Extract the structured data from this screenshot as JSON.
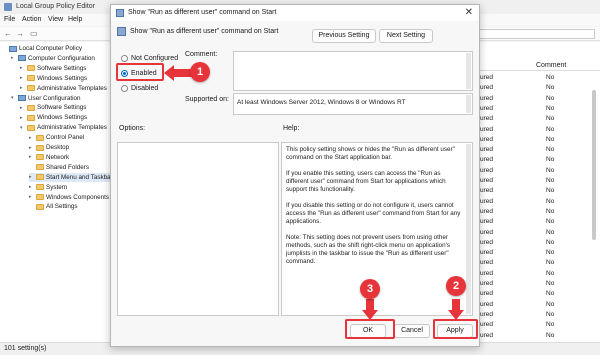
{
  "app": {
    "title": "Local Group Policy Editor",
    "menu": [
      "File",
      "Action",
      "View",
      "Help"
    ],
    "status": "101 setting(s)"
  },
  "tree": [
    {
      "label": "Local Computer Policy",
      "icon": "computer-icon",
      "depth": 0,
      "twisty": ""
    },
    {
      "label": "Computer Configuration",
      "icon": "computer-icon",
      "depth": 1,
      "twisty": "▸"
    },
    {
      "label": "Software Settings",
      "icon": "folder-icon",
      "depth": 2,
      "twisty": "▸"
    },
    {
      "label": "Windows Settings",
      "icon": "folder-icon",
      "depth": 2,
      "twisty": "▸"
    },
    {
      "label": "Administrative Templates",
      "icon": "folder-icon",
      "depth": 2,
      "twisty": "▸"
    },
    {
      "label": "User Configuration",
      "icon": "computer-icon",
      "depth": 1,
      "twisty": "▾"
    },
    {
      "label": "Software Settings",
      "icon": "folder-icon",
      "depth": 2,
      "twisty": "▸"
    },
    {
      "label": "Windows Settings",
      "icon": "folder-icon",
      "depth": 2,
      "twisty": "▸"
    },
    {
      "label": "Administrative Templates",
      "icon": "folder-icon",
      "depth": 2,
      "twisty": "▾"
    },
    {
      "label": "Control Panel",
      "icon": "folder-icon",
      "depth": 3,
      "twisty": "▸"
    },
    {
      "label": "Desktop",
      "icon": "folder-icon",
      "depth": 3,
      "twisty": "▸"
    },
    {
      "label": "Network",
      "icon": "folder-icon",
      "depth": 3,
      "twisty": "▸"
    },
    {
      "label": "Shared Folders",
      "icon": "folder-icon",
      "depth": 3,
      "twisty": ""
    },
    {
      "label": "Start Menu and Taskbar",
      "icon": "folder-icon",
      "depth": 3,
      "twisty": "▸",
      "selected": true
    },
    {
      "label": "System",
      "icon": "folder-icon",
      "depth": 3,
      "twisty": "▸"
    },
    {
      "label": "Windows Components",
      "icon": "folder-icon",
      "depth": 3,
      "twisty": "▸"
    },
    {
      "label": "All Settings",
      "icon": "folder-icon",
      "depth": 3,
      "twisty": ""
    }
  ],
  "list": {
    "header": "Comment",
    "rows": [
      {
        "state": "ured",
        "comment": "No"
      },
      {
        "state": "ured",
        "comment": "No"
      },
      {
        "state": "ured",
        "comment": "No"
      },
      {
        "state": "ured",
        "comment": "No"
      },
      {
        "state": "ured",
        "comment": "No"
      },
      {
        "state": "ured",
        "comment": "No"
      },
      {
        "state": "ured",
        "comment": "No"
      },
      {
        "state": "ured",
        "comment": "No"
      },
      {
        "state": "ured",
        "comment": "No"
      },
      {
        "state": "ured",
        "comment": "No"
      },
      {
        "state": "ured",
        "comment": "No"
      },
      {
        "state": "ured",
        "comment": "No"
      },
      {
        "state": "ured",
        "comment": "No"
      },
      {
        "state": "ured",
        "comment": "No"
      },
      {
        "state": "ured",
        "comment": "No"
      },
      {
        "state": "ured",
        "comment": "No"
      },
      {
        "state": "ured",
        "comment": "No"
      },
      {
        "state": "ured",
        "comment": "No"
      },
      {
        "state": "ured",
        "comment": "No"
      },
      {
        "state": "ured",
        "comment": "No"
      },
      {
        "state": "ured",
        "comment": "No"
      },
      {
        "state": "ured",
        "comment": "No"
      },
      {
        "state": "ured",
        "comment": "No"
      },
      {
        "state": "ured",
        "comment": "No"
      },
      {
        "state": "ured",
        "comment": "No"
      },
      {
        "state": "ured",
        "comment": "No"
      }
    ]
  },
  "dialog": {
    "title": "Show \"Run as different user\" command on Start",
    "subtitle": "Show \"Run as different user\" command on Start",
    "prev_label": "Previous Setting",
    "next_label": "Next Setting",
    "options": [
      {
        "label": "Not Configured",
        "selected": false
      },
      {
        "label": "Enabled",
        "selected": true
      },
      {
        "label": "Disabled",
        "selected": false
      }
    ],
    "comment_label": "Comment:",
    "supported_label": "Supported on:",
    "supported_value": "At least Windows Server 2012, Windows 8 or Windows RT",
    "options_label": "Options:",
    "help_label": "Help:",
    "help_paragraphs": [
      "This policy setting shows or hides the \"Run as different user\" command on the Start application bar.",
      "If you enable this setting, users can access the \"Run as different user\" command from Start for applications which support this functionality.",
      "If you disable this setting or do not configure it, users cannot access the \"Run as different user\" command from Start for any applications.",
      "Note: This setting does not prevent users from using other methods, such as the shift right-click menu on application's jumplists in the taskbar to issue the \"Run as different user\" command."
    ],
    "ok_label": "OK",
    "cancel_label": "Cancel",
    "apply_label": "Apply"
  },
  "annotations": {
    "color": "#e6343a",
    "steps": [
      "1",
      "2",
      "3"
    ]
  }
}
